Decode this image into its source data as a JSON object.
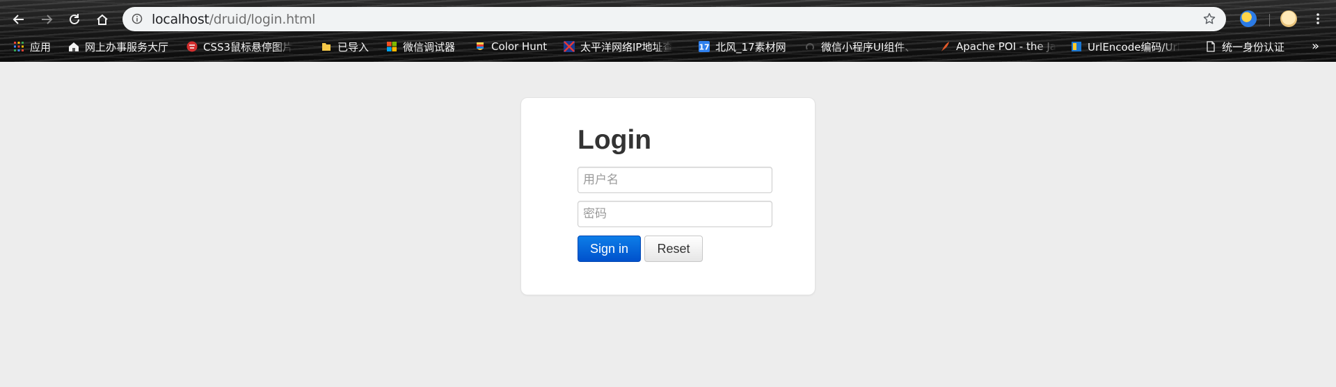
{
  "browser": {
    "url_host": "localhost",
    "url_path": "/druid/login.html",
    "bookmarks": [
      {
        "label": "应用",
        "icon": "apps-grid-icon"
      },
      {
        "label": "网上办事服务大厅",
        "icon": "house-icon"
      },
      {
        "label": "CSS3鼠标悬停图片",
        "icon": "css-icon"
      },
      {
        "label": "已导入",
        "icon": "folder-icon"
      },
      {
        "label": "微信调试器",
        "icon": "windows-logo-icon"
      },
      {
        "label": "Color Hunt",
        "icon": "colorhunt-icon"
      },
      {
        "label": "太平洋网络IP地址查",
        "icon": "pconline-icon"
      },
      {
        "label": "北风_17素材网",
        "icon": "number-17-icon"
      },
      {
        "label": "微信小程序UI组件、",
        "icon": "weixin-icon"
      },
      {
        "label": "Apache POI - the Ja",
        "icon": "feather-icon"
      },
      {
        "label": "UrlEncode编码/Url",
        "icon": "urlencode-icon"
      },
      {
        "label": "统一身份认证",
        "icon": "page-icon"
      }
    ],
    "more_bookmarks": "»"
  },
  "login": {
    "title": "Login",
    "username_placeholder": "用户名",
    "password_placeholder": "密码",
    "signin_label": "Sign in",
    "reset_label": "Reset"
  },
  "colors": {
    "page_background": "#ededed",
    "primary_button": "#0066d9",
    "title_text": "#333333"
  }
}
